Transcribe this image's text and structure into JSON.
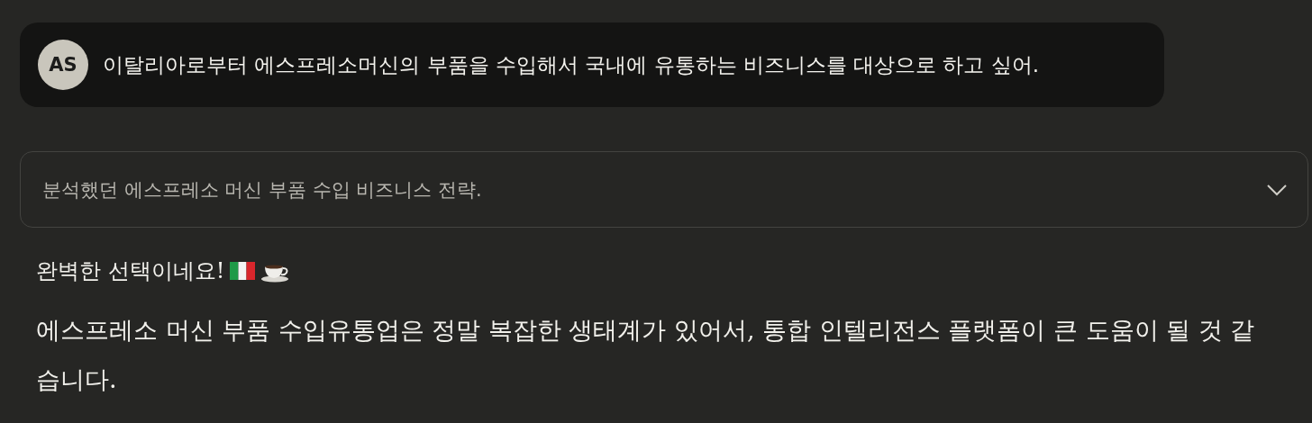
{
  "user_message": {
    "avatar": "AS",
    "text": "이탈리아로부터 에스프레소머신의 부품을 수입해서 국내에 유통하는 비즈니스를 대상으로 하고 싶어."
  },
  "thinking_summary": {
    "text": "분석했던 에스프레소 머신 부품 수입 비즈니스 전략.",
    "expanded": false
  },
  "response": {
    "heading": "완벽한 선택이네요!",
    "paragraph": "에스프레소 머신 부품 수입유통업은 정말 복잡한 생태계가 있어서, 통합 인텔리전스 플랫폼이 큰 도움이 될 것 같습니다."
  }
}
